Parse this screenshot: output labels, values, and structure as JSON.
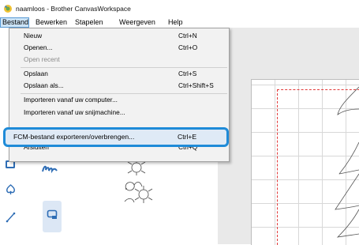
{
  "window": {
    "title": "naamloos - Brother CanvasWorkspace",
    "app_icon": "canvasworkspace-logo-icon"
  },
  "menubar": {
    "items": [
      "Bestand",
      "Bewerken",
      "Stapelen",
      "Weergeven",
      "Help"
    ],
    "active": "Bestand"
  },
  "file_menu": {
    "items": [
      {
        "label": "Nieuw",
        "shortcut": "Ctrl+N",
        "enabled": true
      },
      {
        "label": "Openen...",
        "shortcut": "Ctrl+O",
        "enabled": true
      },
      {
        "label": "Open recent",
        "shortcut": "",
        "enabled": false
      },
      {
        "label": "Opslaan",
        "shortcut": "Ctrl+S",
        "enabled": true
      },
      {
        "label": "Opslaan als...",
        "shortcut": "Ctrl+Shift+S",
        "enabled": true
      },
      {
        "label": "Importeren vanaf uw computer...",
        "shortcut": "",
        "enabled": true
      },
      {
        "label": "Importeren vanaf uw snijmachine...",
        "shortcut": "",
        "enabled": true
      },
      {
        "label": "FCM-bestand exporteren/overbrengen...",
        "shortcut": "Ctrl+E",
        "enabled": true,
        "highlighted": true
      },
      {
        "label": "Afsluiten",
        "shortcut": "Ctrl+Q",
        "enabled": true
      }
    ]
  },
  "tools": {
    "icons": [
      "image-tool-icon",
      "shape-tool-icon",
      "line-tool-icon",
      "cursive-text-icon",
      "rectangle-tool-icon"
    ]
  },
  "colors": {
    "highlight_border": "#1f8bd8",
    "menu_active_bg": "#cce4f7",
    "cut_frame": "#e23a3a",
    "icon_blue": "#2e6db5"
  }
}
